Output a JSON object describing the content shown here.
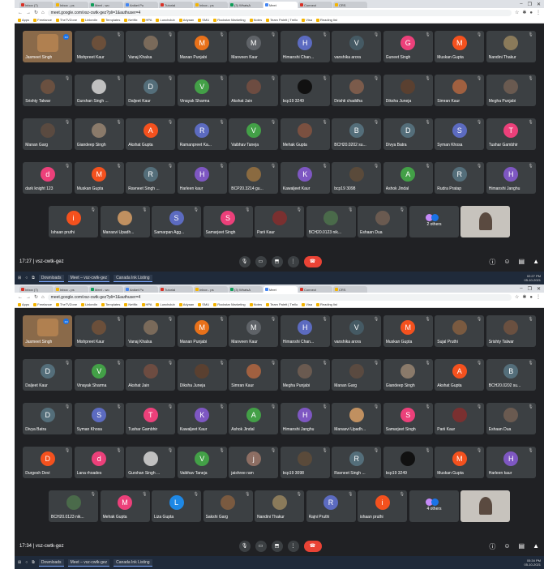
{
  "browser": {
    "tabs": [
      "Inbox (7)",
      "Inbox - ps",
      "Meet - wo",
      "Aniket Pu",
      "Tutorial",
      "Inbox - ps",
      "(3) WhatsA",
      "Meet",
      "Connect",
      "CRS"
    ],
    "url": "meet.google.com/vsz-cwtk-gez?pli=1&authuser=4",
    "bookmarks": [
      "Apps",
      "Freelance",
      "TheTVZone",
      "LinkedIn",
      "Templates",
      "Netflix",
      "HPA",
      "Lunchclub",
      "Adyaan",
      "SMU",
      "Rockstar Marketing",
      "Notes",
      "Team Palett | Trello",
      "Visa",
      "Reading list"
    ],
    "controls": [
      "–",
      "❐",
      "✕"
    ]
  },
  "frame1": {
    "time": "17:27",
    "code": "vsz-cwtk-gez",
    "grid_rows": [
      [
        {
          "n": "Jasmeet Singh",
          "t": "me"
        },
        {
          "n": "Mishpreet Kaur",
          "t": "photo",
          "c": "#6b4f3a"
        },
        {
          "n": "Vanaj Khalsa",
          "t": "photo",
          "c": "#7a6a5a"
        },
        {
          "n": "Manan Punjabi",
          "l": "M",
          "c": "#e8711a"
        },
        {
          "n": "Manveen Kaur",
          "l": "M",
          "c": "#5f6368"
        },
        {
          "n": "Himanshi Chan...",
          "l": "H",
          "c": "#5c6bc0"
        },
        {
          "n": "vanshika arora",
          "l": "V",
          "c": "#455a64"
        },
        {
          "n": "Guneet Singh",
          "l": "G",
          "c": "#ec407a"
        },
        {
          "n": "Muskan Gupta",
          "l": "M",
          "c": "#f4511e"
        },
        {
          "n": "Nandini Thakur",
          "t": "photo",
          "c": "#8a7a5a"
        }
      ],
      [
        {
          "n": "Srishty Talwar",
          "t": "photo",
          "c": "#6a5040"
        },
        {
          "n": "Gurshan Singh ...",
          "t": "photo",
          "c": "#c0c0c0"
        },
        {
          "n": "Daljeet Kaur",
          "l": "D",
          "c": "#546e7a"
        },
        {
          "n": "Vinayak Sharma",
          "l": "V",
          "c": "#43a047"
        },
        {
          "n": "Akshat Jain",
          "t": "photo",
          "c": "#6d4c41"
        },
        {
          "n": "bcp19 3249",
          "t": "photo",
          "c": "#111111"
        },
        {
          "n": "Drishti chaddha",
          "t": "photo",
          "c": "#7b5b4b"
        },
        {
          "n": "Diksha Juneja",
          "t": "photo",
          "c": "#5a4030"
        },
        {
          "n": "Simran Kaur",
          "t": "photo",
          "c": "#a06040"
        },
        {
          "n": "Megha Punjabi",
          "t": "photo",
          "c": "#6a5a50"
        }
      ],
      [
        {
          "n": "Manan Garg",
          "t": "photo",
          "c": "#5a4a40"
        },
        {
          "n": "Giandeep Singh",
          "t": "photo",
          "c": "#8a7a6a"
        },
        {
          "n": "Akshat Gupta",
          "l": "A",
          "c": "#f4511e"
        },
        {
          "n": "Ramanpreet Ka...",
          "l": "R",
          "c": "#5c6bc0"
        },
        {
          "n": "Vaibhav Taneja",
          "l": "V",
          "c": "#43a047"
        },
        {
          "n": "Mehak Gupta",
          "t": "photo",
          "c": "#7a5040"
        },
        {
          "n": "BCH20.0202 su...",
          "l": "B",
          "c": "#546e7a"
        },
        {
          "n": "Divya Batra",
          "l": "D",
          "c": "#546e7a"
        },
        {
          "n": "Syman Khosa",
          "l": "S",
          "c": "#5c6bc0"
        },
        {
          "n": "Tushar Gambhir",
          "l": "T",
          "c": "#ec407a"
        }
      ],
      [
        {
          "n": "dark knight 123",
          "l": "d",
          "c": "#ec407a"
        },
        {
          "n": "Muskan Gupta",
          "l": "M",
          "c": "#f4511e"
        },
        {
          "n": "Ravneet Singh ...",
          "l": "R",
          "c": "#546e7a"
        },
        {
          "n": "Harleen kaur",
          "l": "H",
          "c": "#7e57c2"
        },
        {
          "n": "BCP20.3214 gu...",
          "t": "photo",
          "c": "#8a6a40"
        },
        {
          "n": "Kawaljeet Kaur",
          "l": "K",
          "c": "#7e57c2"
        },
        {
          "n": "bcp19 3098",
          "t": "photo",
          "c": "#5a4a3a"
        },
        {
          "n": "Ashok Jindal",
          "l": "A",
          "c": "#43a047"
        },
        {
          "n": "Rudra Pratap",
          "l": "R",
          "c": "#546e7a"
        },
        {
          "n": "Himanshi Janghu",
          "l": "H",
          "c": "#7e57c2"
        }
      ],
      [
        {
          "n": "Ishaan pruthi",
          "l": "i",
          "c": "#f4511e"
        },
        {
          "n": "Manasvi Upadh...",
          "t": "photo",
          "c": "#c09060"
        },
        {
          "n": "Samarpan Agg...",
          "l": "S",
          "c": "#5c6bc0"
        },
        {
          "n": "Samarjeet Singh",
          "l": "S",
          "c": "#ec407a"
        },
        {
          "n": "Parii Kaur",
          "t": "photo",
          "c": "#7a3030"
        },
        {
          "n": "BCH20.0123 nik...",
          "t": "photo",
          "c": "#4a6a4a"
        },
        {
          "n": "Eshaan Dua",
          "t": "photo",
          "c": "#6a5a50"
        },
        {
          "n": "2 others",
          "t": "others"
        },
        {
          "n": "",
          "t": "cam"
        }
      ]
    ],
    "taskbar": {
      "items": [
        "Downloads",
        "Meet – vsz-cwtk-gez",
        "Canada Ink Listing"
      ],
      "time": "02:27 PM",
      "date": "05-10-2021"
    }
  },
  "frame2": {
    "time": "17:34",
    "code": "vsz-cwtk-gez",
    "grid_rows": [
      [
        {
          "n": "Jasmeet Singh",
          "t": "me"
        },
        {
          "n": "Mishpreet Kaur",
          "t": "photo",
          "c": "#6b4f3a"
        },
        {
          "n": "Vanaj Khalsa",
          "t": "photo",
          "c": "#7a6a5a"
        },
        {
          "n": "Manan Punjabi",
          "l": "M",
          "c": "#e8711a"
        },
        {
          "n": "Manveen Kaur",
          "l": "M",
          "c": "#5f6368"
        },
        {
          "n": "Himanshi Chan...",
          "l": "H",
          "c": "#5c6bc0"
        },
        {
          "n": "vanshika arora",
          "l": "V",
          "c": "#455a64"
        },
        {
          "n": "Muskan Gupta",
          "l": "M",
          "c": "#f4511e"
        },
        {
          "n": "Sujal Pruthi",
          "t": "photo",
          "c": "#7a5a40"
        },
        {
          "n": "Srishty Talwar",
          "t": "photo",
          "c": "#6a5040"
        }
      ],
      [
        {
          "n": "Daljeet Kaur",
          "l": "D",
          "c": "#546e7a"
        },
        {
          "n": "Vinayak Sharma",
          "l": "V",
          "c": "#43a047"
        },
        {
          "n": "Akshat Jain",
          "t": "photo",
          "c": "#6d4c41"
        },
        {
          "n": "Diksha Juneja",
          "t": "photo",
          "c": "#5a4030"
        },
        {
          "n": "Simran Kaur",
          "t": "photo",
          "c": "#a06040"
        },
        {
          "n": "Megha Punjabi",
          "t": "photo",
          "c": "#6a5a50"
        },
        {
          "n": "Manan Garg",
          "t": "photo",
          "c": "#5a4a40"
        },
        {
          "n": "Giandeep Singh",
          "t": "photo",
          "c": "#8a7a6a"
        },
        {
          "n": "Akshat Gupta",
          "l": "A",
          "c": "#f4511e"
        },
        {
          "n": "BCH20.0202 su...",
          "l": "B",
          "c": "#546e7a"
        }
      ],
      [
        {
          "n": "Divya Batra",
          "l": "D",
          "c": "#546e7a"
        },
        {
          "n": "Syman Khosa",
          "l": "S",
          "c": "#5c6bc0"
        },
        {
          "n": "Tushar Gambhir",
          "l": "T",
          "c": "#ec407a"
        },
        {
          "n": "Kawaljeet Kaur",
          "l": "K",
          "c": "#7e57c2"
        },
        {
          "n": "Ashok Jindal",
          "l": "A",
          "c": "#43a047"
        },
        {
          "n": "Himanshi Janghu",
          "l": "H",
          "c": "#7e57c2"
        },
        {
          "n": "Manasvi Upadh...",
          "t": "photo",
          "c": "#c09060"
        },
        {
          "n": "Samarjeet Singh",
          "l": "S",
          "c": "#ec407a"
        },
        {
          "n": "Parii Kaur",
          "t": "photo",
          "c": "#7a3030"
        },
        {
          "n": "Eshaan Dua",
          "t": "photo",
          "c": "#6a5a50"
        }
      ],
      [
        {
          "n": "Durgesh Devi",
          "l": "D",
          "c": "#f4511e"
        },
        {
          "n": "Lana rhoades",
          "l": "d",
          "c": "#ec407a"
        },
        {
          "n": "Gurshan Singh ...",
          "t": "photo",
          "c": "#c0c0c0"
        },
        {
          "n": "Vaibhav Taneja",
          "l": "V",
          "c": "#43a047"
        },
        {
          "n": "jaishree ram",
          "l": "j",
          "c": "#8d6e63"
        },
        {
          "n": "bcp19 3098",
          "t": "photo",
          "c": "#5a4a3a"
        },
        {
          "n": "Ravneet Singh ...",
          "l": "R",
          "c": "#546e7a"
        },
        {
          "n": "bcp19 3249",
          "t": "photo",
          "c": "#111111"
        },
        {
          "n": "Muskan Gupta",
          "l": "M",
          "c": "#f4511e"
        },
        {
          "n": "Harleen kaur",
          "l": "H",
          "c": "#7e57c2"
        }
      ],
      [
        {
          "n": "BCH20.0123 nik...",
          "t": "photo",
          "c": "#4a6a4a"
        },
        {
          "n": "Mehak Gupta",
          "l": "M",
          "c": "#ec407a"
        },
        {
          "n": "Liza Gupta",
          "l": "L",
          "c": "#1e88e5"
        },
        {
          "n": "Sakshi Garg",
          "t": "photo",
          "c": "#7a5a40"
        },
        {
          "n": "Nandini Thakur",
          "t": "photo",
          "c": "#8a7a5a"
        },
        {
          "n": "Rajni Pruthi",
          "l": "R",
          "c": "#5c6bc0"
        },
        {
          "n": "ishaan pruthi",
          "l": "i",
          "c": "#f4511e"
        },
        {
          "n": "4 others",
          "t": "others"
        },
        {
          "n": "",
          "t": "cam"
        }
      ]
    ],
    "taskbar": {
      "items": [
        "Downloads",
        "Meet – vsz-cwtk-gez",
        "Canada Ink Listing"
      ],
      "time": "05:34 PM",
      "date": "05-10-2021"
    }
  },
  "icons": {
    "mic": "mic-icon",
    "cam": "camera-icon",
    "present": "present-icon",
    "more": "more-icon",
    "end": "end-call-icon",
    "info": "info-icon",
    "people": "people-icon",
    "chat": "chat-icon",
    "activities": "activities-icon"
  }
}
